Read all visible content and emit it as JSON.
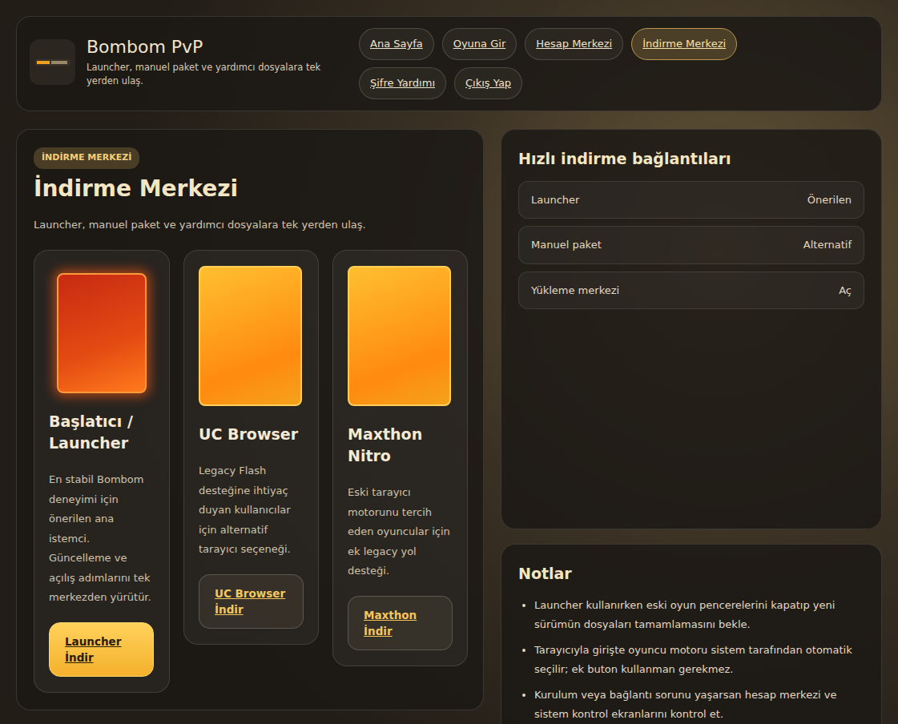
{
  "header": {
    "title": "Bombom PvP",
    "subtitle": "Launcher, manuel paket ve yardımcı dosyalara tek yerden ulaş."
  },
  "nav": [
    {
      "label": "Ana Sayfa",
      "selected": false
    },
    {
      "label": "Oyuna Gir",
      "selected": false
    },
    {
      "label": "Hesap Merkezi",
      "selected": false
    },
    {
      "label": "İndirme Merkezi",
      "selected": true
    },
    {
      "label": "Şifre Yardımı",
      "selected": false
    },
    {
      "label": "Çıkış Yap",
      "selected": false
    }
  ],
  "section": {
    "kicker": "İNDİRME MERKEZİ",
    "title": "İndirme Merkezi",
    "description": "Launcher, manuel paket ve yardımcı dosyalara tek yerden ulaş."
  },
  "downloads": [
    {
      "title": "Başlatıcı / Launcher",
      "description": "En stabil Bombom deneyimi için önerilen ana istemci. Güncelleme ve açılış adımlarını tek merkezden yürütür.",
      "button": "Launcher İndir",
      "kind": "primary"
    },
    {
      "title": "UC Browser",
      "description": "Legacy Flash desteğine ihtiyaç duyan kullanıcılar için alternatif tarayıcı seçeneği.",
      "button": "UC Browser İndir",
      "kind": "secondary"
    },
    {
      "title": "Maxthon Nitro",
      "description": "Eski tarayıcı motorunu tercih eden oyuncular için ek legacy yol desteği.",
      "button": "Maxthon İndir",
      "kind": "secondary"
    }
  ],
  "quick_links": {
    "title": "Hızlı indirme bağlantıları",
    "items": [
      {
        "label": "Launcher",
        "tag": "Önerilen"
      },
      {
        "label": "Manuel paket",
        "tag": "Alternatif"
      },
      {
        "label": "Yükleme merkezi",
        "tag": "Aç"
      }
    ]
  },
  "notes": {
    "title": "Notlar",
    "items": [
      "Launcher kullanırken eski oyun pencerelerini kapatıp yeni sürümün dosyaları tamamlamasını bekle.",
      "Tarayıcıyla girişte oyuncu motoru sistem tarafından otomatik seçilir; ek buton kullanman gerekmez.",
      "Kurulum veya bağlantı sorunu yaşarsan hesap merkezi ve sistem kontrol ekranlarını kontrol et."
    ]
  }
}
